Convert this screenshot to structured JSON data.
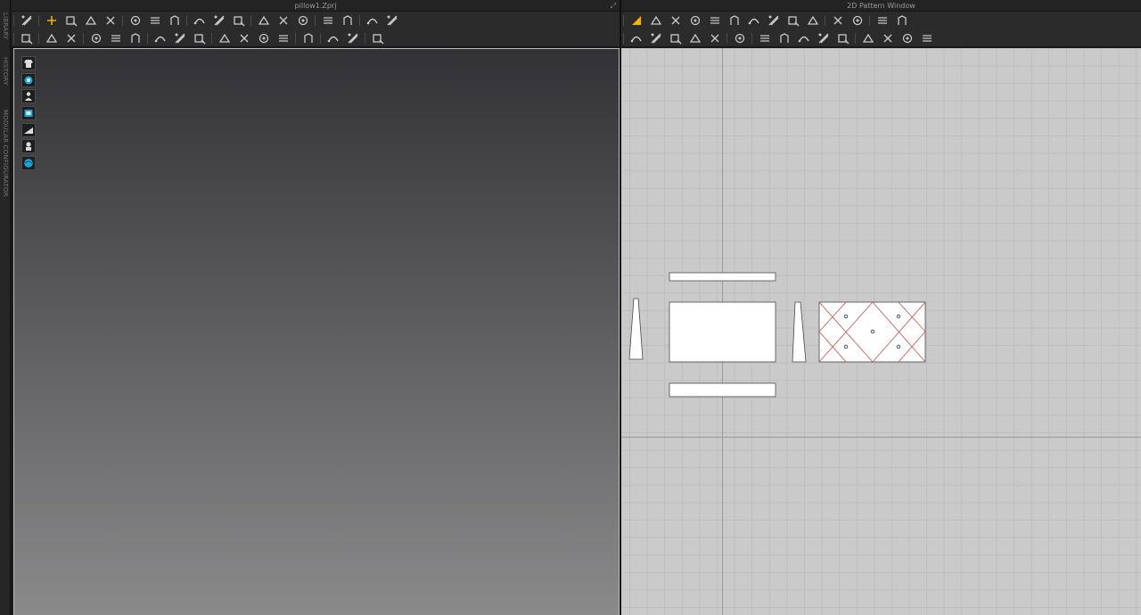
{
  "window_3d": {
    "title": "pillow1.Zprj",
    "expand_icon": "expand-window-icon"
  },
  "window_2d": {
    "title": "2D Pattern Window"
  },
  "side_dock": {
    "tabs": [
      "LIBRARY",
      "HISTORY",
      "MODULAR CONFIGURATOR"
    ]
  },
  "colors": {
    "viewport_top": "#323235",
    "viewport_bottom": "#8a8a8b",
    "pattern_bg": "#cacaca",
    "grid_line": "#bebebe",
    "internal_line": "#c0504d",
    "tool_accent": "#f0b400",
    "side_tool_accent": "#1aa6e0"
  },
  "toolbar_3d_row1": [
    [
      "select-move-icon"
    ],
    [
      "transform-pattern-icon",
      "select-mesh-icon",
      "fold-arrangement-icon",
      "tack-icon"
    ],
    [
      "pin-icon",
      "pin-box-icon",
      "pin-remove-icon"
    ],
    [
      "measure-line-icon",
      "tape-icon",
      "shirt-display-icon"
    ],
    [
      "strengthen-icon",
      "shrinkage-icon",
      "iron-icon"
    ],
    [
      "avatar-show-icon",
      "avatar-hide-icon"
    ],
    [
      "grid-icon",
      "mesh-grid-icon"
    ]
  ],
  "toolbar_3d_row2": [
    [
      "simulation-icon"
    ],
    [
      "edit-pattern-icon",
      "cut-icon"
    ],
    [
      "segment-icon",
      "scissor-icon",
      "layer-icon"
    ],
    [
      "style-line-icon",
      "gathering-icon",
      "quilting-icon"
    ],
    [
      "button-icon",
      "buttonhole-icon",
      "zipper-icon",
      "stitch-icon"
    ],
    [
      "trim-icon"
    ],
    [
      "puckering-icon",
      "fabric-icon"
    ],
    [
      "align-icon"
    ]
  ],
  "toolbar_2d_row1": [
    [
      "edit-pattern-2d-icon",
      "edit-point-icon",
      "edit-curvature-icon",
      "curve-point-icon",
      "add-point-icon",
      "slash-spread-icon",
      "fold-icon",
      "trace-icon",
      "create-pattern-icon",
      "offset-icon"
    ],
    [
      "symmetry-icon",
      "unfold-icon"
    ],
    [
      "grid-2d-icon",
      "mesh-2d-icon"
    ]
  ],
  "toolbar_2d_row2": [
    [
      "rectangle-icon",
      "polygon-icon",
      "circle-icon",
      "dart-icon",
      "internal-rect-icon"
    ],
    [
      "internal-shape-icon"
    ],
    [
      "sew-segment-icon",
      "sew-free-icon",
      "sew-m-n-icon",
      "check-sewing-icon",
      "sewing-pin-icon"
    ],
    [
      "topstitch-icon",
      "stitch-line-icon",
      "smooth-line-icon",
      "edit-stitch-icon"
    ]
  ],
  "side_tools": [
    "garment-display-icon",
    "fabric-display-icon",
    "avatar-display-icon",
    "texture-display-icon",
    "surface-display-icon",
    "avatar-silhouette-icon",
    "environment-sphere-icon"
  ],
  "patterns": [
    {
      "name": "pattern-top-strip",
      "shape": "rect"
    },
    {
      "name": "pattern-left-gusset",
      "shape": "trapezoid"
    },
    {
      "name": "pattern-front-panel",
      "shape": "rect"
    },
    {
      "name": "pattern-right-gusset",
      "shape": "trapezoid"
    },
    {
      "name": "pattern-quilted-panel",
      "shape": "rect-quilted"
    },
    {
      "name": "pattern-bottom-strip",
      "shape": "rect"
    }
  ]
}
